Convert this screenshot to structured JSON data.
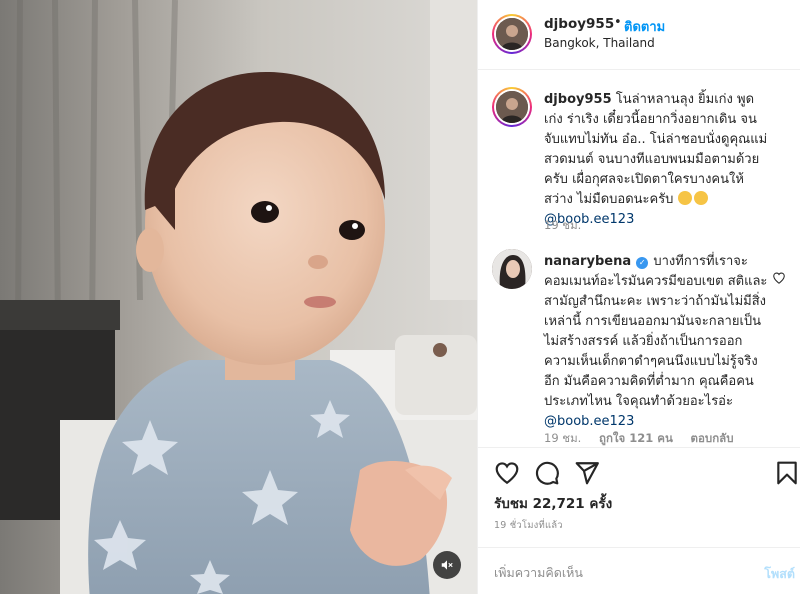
{
  "post": {
    "username": "djboy955",
    "follow_label": "ติดตาม",
    "separator": "•",
    "location": "Bangkok, Thailand"
  },
  "caption": {
    "username": "djboy955",
    "text": "โนล่าหลานลุง ยิ้มเก่ง พูดเก่ง ร่าเริง เดี๋ยวนี้อยากวิ่งอยากเดิน จนจับแทบไม่ทัน อ๋อ.. โน่ล่าชอบนั่งดูคุณแม่สวดมนต์ จนบางทีแอบพนมมือตามด้วยครับ เผื่อกุศลจะเปิดตาใครบางคนให้สว่าง ไม่มืดบอดนะครับ",
    "mention": "@boob.ee123",
    "time": "19 ชม."
  },
  "comment": {
    "username": "nanarybena",
    "verified_mark": "✓",
    "text": "บางทีการที่เราจะคอมเมนท์อะไรมันควรมีขอบเขต สติและสามัญสำนึกนะคะ เพราะว่าถ้ามันไม่มีสิ่งเหล่านี้ การเขียนออกมามันจะกลายเป็นไม่สร้างสรรค์ แล้วยิ่งถ้าเป็นการออกความเห็นเด็กตาดำๆคนนึงแบบไม่รู้จริงอีก มันคือความคิดที่ต่ำมาก คุณคือคนประเภทไหน ใจคุณทำด้วยอะไรอ่ะ",
    "mention": "@boob.ee123",
    "time": "19 ชม.",
    "likes": "ถูกใจ 121 คน",
    "reply_label": "ตอบกลับ"
  },
  "actions": {
    "views": "รับชม 22,721 ครั้ง",
    "time_ago": "19 ชั่วโมงที่แล้ว"
  },
  "add_comment": {
    "placeholder": "เพิ่มความคิดเห็น",
    "post_label": "โพสต์"
  },
  "icons": {
    "like": "heart-icon",
    "comment": "comment-icon",
    "share": "send-icon",
    "save": "bookmark-icon",
    "mute": "speaker-muted-icon"
  },
  "colors": {
    "follow": "#0095f6",
    "mention": "#00376b",
    "verified": "#3897f0",
    "post_disabled": "#b2dffc"
  }
}
